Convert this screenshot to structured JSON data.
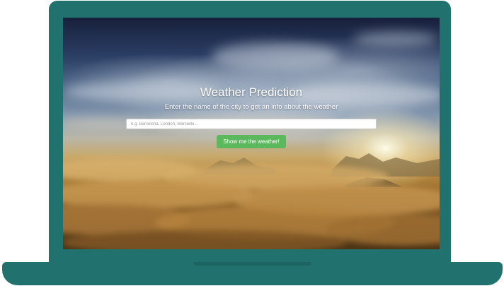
{
  "app": {
    "title": "Weather Prediction",
    "subtitle": "Enter the name of the city to get an info about the weather"
  },
  "search": {
    "placeholder": "e.g. Barcelona, London, Marseille...",
    "value": ""
  },
  "actions": {
    "submit_label": "Show me the weather!"
  },
  "colors": {
    "device_frame": "#21726f",
    "button_bg": "#5cb85c",
    "button_text": "#ffffff",
    "title_text": "#ffffff"
  }
}
